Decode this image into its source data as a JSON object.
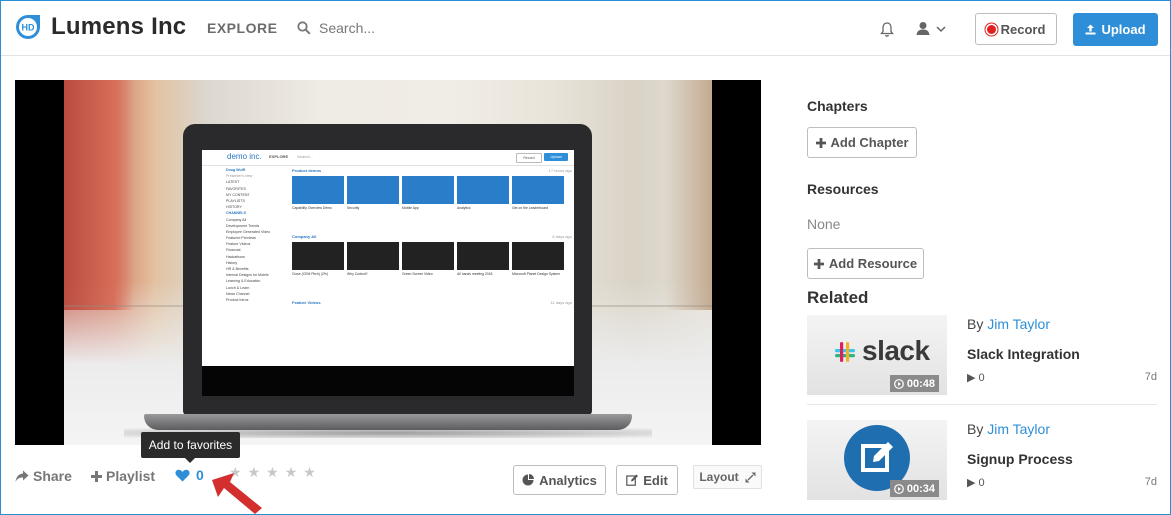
{
  "header": {
    "logo_text": "HD",
    "brand": "Lumens Inc",
    "explore": "EXPLORE",
    "search_placeholder": "Search...",
    "record_label": "Record",
    "upload_label": "Upload"
  },
  "video_screen": {
    "logo": "demo inc.",
    "explore": "EXPLORE",
    "search": "Search...",
    "record": "Record",
    "upload": "Upload",
    "user": "Doug Wulff",
    "user_sub": "Presenter's view",
    "sidebar": [
      "LATEST",
      "FAVORITES",
      "MY CONTENT",
      "PLAYLISTS",
      "HISTORY"
    ],
    "channels_label": "CHANNELS",
    "channels": [
      "Company All",
      "Development Trends",
      "Employee Generated Video",
      "Featured Previews",
      "Feature Videos",
      "Financial",
      "Hackathons",
      "History",
      "HR & Benefits",
      "Internal Designs for Mobile",
      "Learning & Education",
      "Lunch & Learn",
      "News Channel",
      "Product Intros"
    ],
    "row1_title": "Product demos",
    "row1_age": "17 hours ago",
    "row1_items": [
      "Capability Overview Demo",
      "Security",
      "Mobile App",
      "Analytics",
      "Get on the Leaderboard"
    ],
    "row2_title": "Company All",
    "row2_age": "6 days ago",
    "row2_items": [
      "Close (CEM Pitch) (2%)",
      "Why Codeut?",
      "Green Screen Video",
      "All hands meeting 2018",
      "Microsoft Planet Design System"
    ],
    "row3_title": "Feature Videos",
    "row3_age": "11 days ago"
  },
  "actions": {
    "tooltip": "Add to favorites",
    "share": "Share",
    "playlist": "Playlist",
    "favorites_count": "0",
    "rating_stars": 0,
    "analytics": "Analytics",
    "edit": "Edit",
    "layout": "Layout"
  },
  "sidebar": {
    "chapters_heading": "Chapters",
    "add_chapter": "Add Chapter",
    "resources_heading": "Resources",
    "resources_value": "None",
    "add_resource": "Add Resource",
    "related_heading": "Related",
    "related": [
      {
        "by": "By",
        "author": "Jim Taylor",
        "title": "Slack Integration",
        "views": "0",
        "age": "7d",
        "duration": "00:48",
        "thumb_text": "slack"
      },
      {
        "by": "By",
        "author": "Jim Taylor",
        "title": "Signup Process",
        "views": "0",
        "age": "7d",
        "duration": "00:34",
        "thumb_text": ""
      }
    ]
  },
  "colors": {
    "accent": "#2e8fd8",
    "record_red": "#e02020",
    "arrow_red": "#d32f2f"
  }
}
